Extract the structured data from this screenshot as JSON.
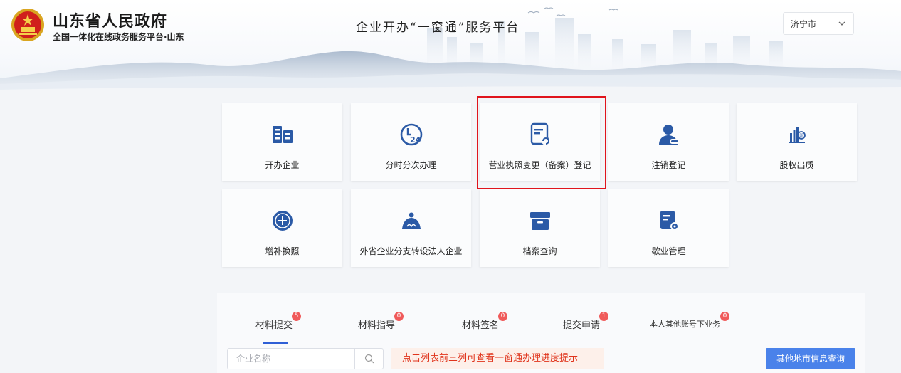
{
  "header": {
    "gov_title": "山东省人民政府",
    "gov_subtitle": "全国一体化在线政务服务平台·山东",
    "platform_title": "企业开办“一窗通”服务平台",
    "city_select": {
      "value": "济宁市"
    }
  },
  "services": [
    {
      "label": "开办企业",
      "icon": "building-icon"
    },
    {
      "label": "分时分次办理",
      "icon": "clock-24-icon"
    },
    {
      "label": "营业执照变更（备案）登记",
      "icon": "document-refresh-icon"
    },
    {
      "label": "注销登记",
      "icon": "user-remove-icon"
    },
    {
      "label": "股权出质",
      "icon": "equity-chart-icon"
    },
    {
      "label": "增补换照",
      "icon": "plus-circle-icon"
    },
    {
      "label": "外省企业分支转设法人企业",
      "icon": "branch-transfer-icon"
    },
    {
      "label": "档案查询",
      "icon": "archive-box-icon"
    },
    {
      "label": "歇业管理",
      "icon": "document-gear-icon"
    }
  ],
  "tabs": [
    {
      "label": "材料提交",
      "count": "5"
    },
    {
      "label": "材料指导",
      "count": "0"
    },
    {
      "label": "材料签名",
      "count": "0"
    },
    {
      "label": "提交申请",
      "count": "1"
    },
    {
      "label": "本人其他账号下业务",
      "count": "0"
    }
  ],
  "search": {
    "placeholder": "企业名称"
  },
  "tip": "点击列表前三列可查看一窗通办理进度提示",
  "query_button": "其他地市信息查询",
  "colors": {
    "accent": "#2f5fd6",
    "icon": "#2b5aa6",
    "highlight": "#e0141c",
    "badge": "#f05a5a",
    "button": "#4a82ea"
  }
}
